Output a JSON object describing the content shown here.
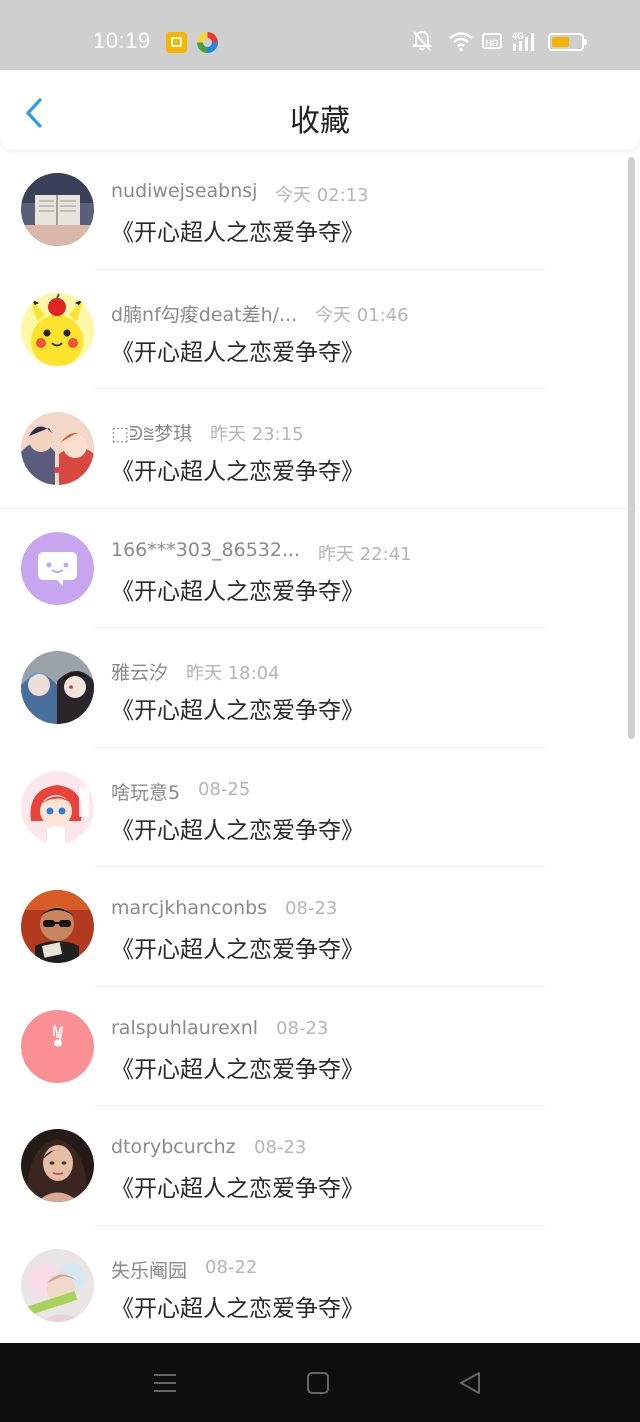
{
  "status_bar": {
    "time": "10:19",
    "hd_label": "HD",
    "battery_level": 0.6,
    "icons": [
      "message-app-icon",
      "browser-app-icon",
      "mute-bell-icon",
      "wifi-icon",
      "hd-icon",
      "4g-signal-icon",
      "battery-icon"
    ]
  },
  "header": {
    "title": "收藏",
    "back_icon": "back-chevron-icon",
    "accent_color": "#2a9af3"
  },
  "items": [
    {
      "name": "nudiwejseabnsj",
      "time": "今天 02:13",
      "message": "《开心超人之恋爱争夺》",
      "avatar": "avatar-book"
    },
    {
      "name": "d腩nf勾痠deat差h/...",
      "time": "今天 01:46",
      "message": "《开心超人之恋爱争夺》",
      "avatar": "avatar-pikachu"
    },
    {
      "name": "⬚ᕲ⩰梦琪",
      "time": "昨天 23:15",
      "message": "《开心超人之恋爱争夺》",
      "avatar": "avatar-anime-pair"
    },
    {
      "name": "166***303_86532...",
      "time": "昨天 22:41",
      "message": "《开心超人之恋爱争夺》",
      "avatar": "avatar-chat-bubble"
    },
    {
      "name": "雅云汐",
      "time": "昨天 18:04",
      "message": "《开心超人之恋爱争夺》",
      "avatar": "avatar-anime-dark"
    },
    {
      "name": "啥玩意5",
      "time": "08-25",
      "message": "《开心超人之恋爱争夺》",
      "avatar": "avatar-anime-red"
    },
    {
      "name": "marcjkhanconbs",
      "time": "08-23",
      "message": "《开心超人之恋爱争夺》",
      "avatar": "avatar-sunglasses"
    },
    {
      "name": "ralspuhlaurexnl",
      "time": "08-23",
      "message": "《开心超人之恋爱争夺》",
      "avatar": "avatar-pink-rabbit"
    },
    {
      "name": "dtorybcurchz",
      "time": "08-23",
      "message": "《开心超人之恋爱争夺》",
      "avatar": "avatar-portrait"
    },
    {
      "name": "失乐阉园",
      "time": "08-22",
      "message": "《开心超人之恋爱争夺》",
      "avatar": "avatar-pastel"
    }
  ],
  "nav_bar": {
    "icons": [
      "menu-icon",
      "home-icon",
      "back-triangle-icon"
    ]
  }
}
